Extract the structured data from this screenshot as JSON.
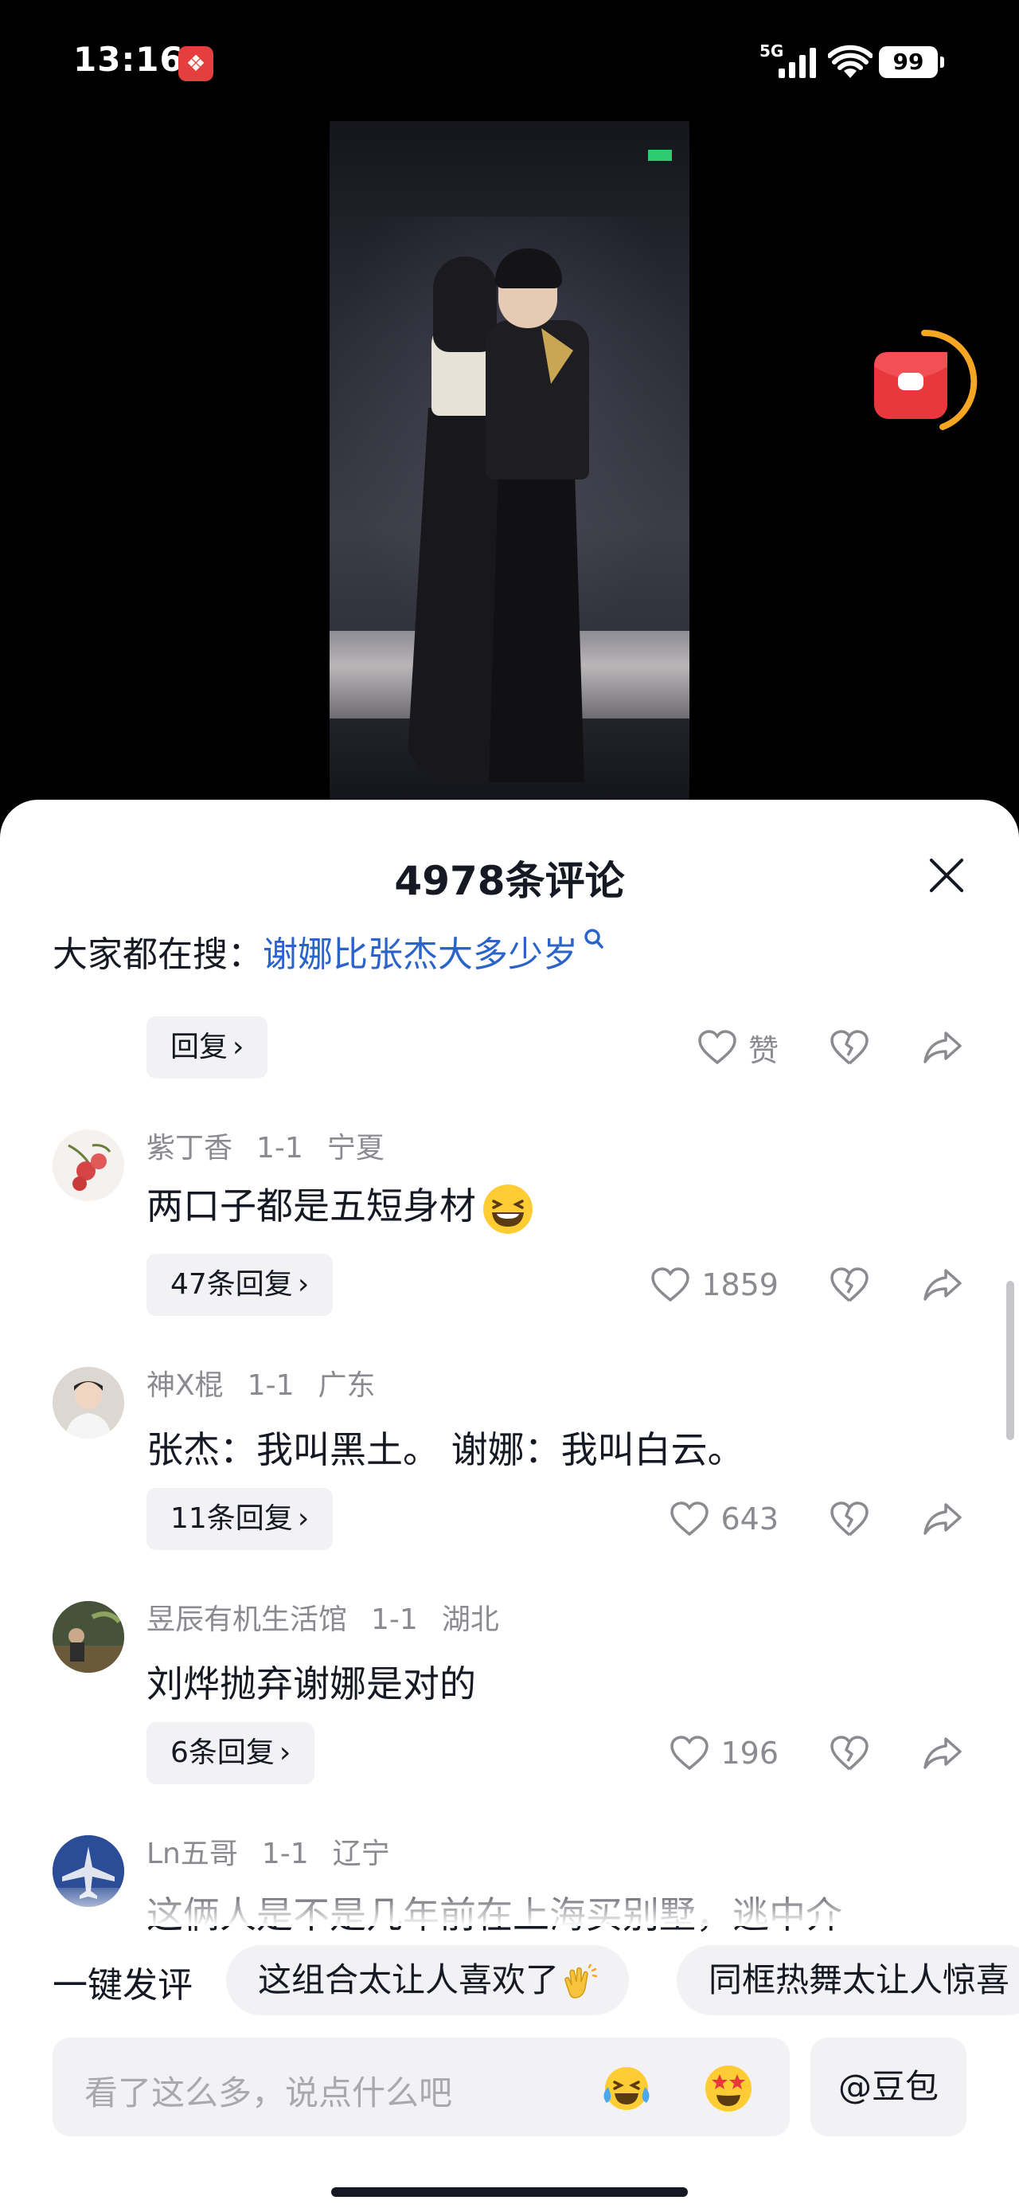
{
  "status_bar": {
    "time": "13:16",
    "network": "5G",
    "battery": "99"
  },
  "sheet": {
    "title": "4978条评论",
    "search_hint_prefix": "大家都在搜：",
    "search_hint_query": "谢娜比张杰大多少岁"
  },
  "first_item": {
    "reply_label": "回复",
    "like_label": "赞"
  },
  "comments": [
    {
      "user": "紫丁香",
      "date": "1-1",
      "region": "宁夏",
      "text": "两口子都是五短身材",
      "emoji": "laugh-emoji",
      "replies": "47条回复",
      "likes": "1859"
    },
    {
      "user": "神X棍",
      "date": "1-1",
      "region": "广东",
      "text": "张杰：我叫黑土。 谢娜：我叫白云。",
      "replies": "11条回复",
      "likes": "643"
    },
    {
      "user": "昱辰有机生活馆",
      "date": "1-1",
      "region": "湖北",
      "text": "刘烨抛弃谢娜是对的",
      "replies": "6条回复",
      "likes": "196"
    },
    {
      "user": "Ln五哥",
      "date": "1-1",
      "region": "辽宁",
      "text": "这俩人是不是几年前在上海买别墅，逃中介"
    }
  ],
  "quick_comments": {
    "label": "一键发评",
    "chips": [
      "这组合太让人喜欢了",
      "同框热舞太让人惊喜"
    ]
  },
  "input": {
    "placeholder": "看了这么多，说点什么吧",
    "doubao_label": "@豆包"
  },
  "icons": {
    "chevron": "chevron-right-icon",
    "like": "heart-outline-icon",
    "dislike": "broken-heart-icon",
    "share": "share-arrow-icon"
  },
  "colors": {
    "link": "#2a63c9",
    "muted": "#8a8b91",
    "chip_bg": "#f2f2f4",
    "accent_orange": "#f5a623"
  }
}
